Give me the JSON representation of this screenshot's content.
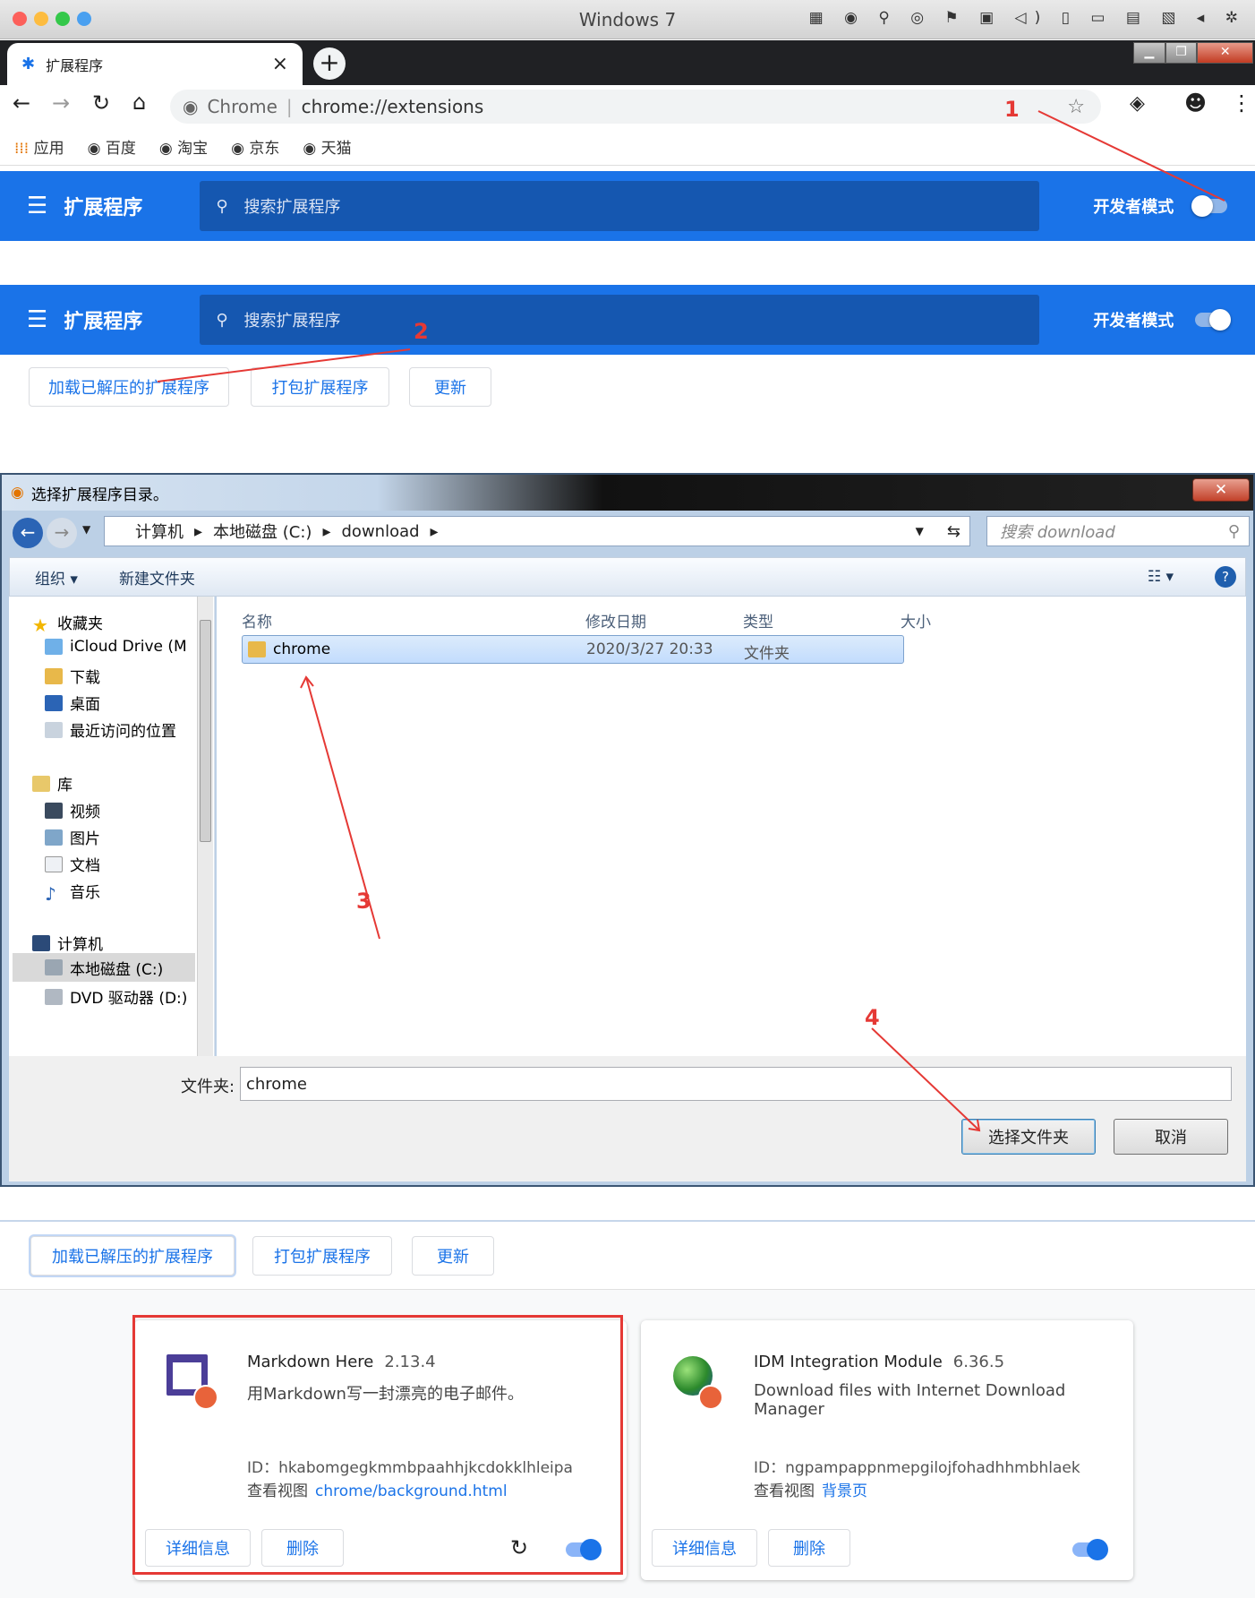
{
  "mac": {
    "title": "Windows 7",
    "icons": "▦ ◉ ⚲ ◎ ⚑ ▣ ◁) ▯ ▭ ▤ ▧ ◂ ✲"
  },
  "tab": {
    "title": "扩展程序",
    "close": "×"
  },
  "omnibox": {
    "site": "Chrome",
    "sep": "|",
    "url": "chrome://extensions"
  },
  "bookmarks": [
    {
      "label": "应用"
    },
    {
      "label": "百度"
    },
    {
      "label": "淘宝"
    },
    {
      "label": "京东"
    },
    {
      "label": "天猫"
    }
  ],
  "ext_header": {
    "title": "扩展程序",
    "search_placeholder": "搜索扩展程序",
    "dev_mode": "开发者模式"
  },
  "dev_buttons": {
    "load": "加载已解压的扩展程序",
    "pack": "打包扩展程序",
    "update": "更新"
  },
  "dialog": {
    "title": "选择扩展程序目录。",
    "breadcrumb": [
      "计算机",
      "本地磁盘 (C:)",
      "download"
    ],
    "search_placeholder": "搜索 download",
    "organize": "组织 ▾",
    "new_folder": "新建文件夹",
    "nav": {
      "favorites": "收藏夹",
      "icloud": "iCloud Drive (M",
      "downloads": "下载",
      "desktop": "桌面",
      "recent": "最近访问的位置",
      "library": "库",
      "videos": "视频",
      "pictures": "图片",
      "documents": "文档",
      "music": "音乐",
      "computer": "计算机",
      "local_disk": "本地磁盘 (C:)",
      "dvd": "DVD 驱动器 (D:)"
    },
    "columns": {
      "name": "名称",
      "modified": "修改日期",
      "type": "类型",
      "size": "大小"
    },
    "file": {
      "name": "chrome",
      "modified": "2020/3/27 20:33",
      "type": "文件夹"
    },
    "folder_label": "文件夹:",
    "folder_value": "chrome",
    "select_button": "选择文件夹",
    "cancel_button": "取消"
  },
  "extensions": [
    {
      "name": "Markdown Here",
      "version": "2.13.4",
      "desc": "用Markdown写一封漂亮的电子邮件。",
      "id": "ID：hkabomgegkmmbpaahhjkcdokklhleipa",
      "views_label": "查看视图",
      "views_link": "chrome/background.html",
      "details": "详细信息",
      "remove": "删除"
    },
    {
      "name": "IDM Integration Module",
      "version": "6.36.5",
      "desc": "Download files with Internet Download Manager",
      "id": "ID：ngpampappnmepgilojfohadhhmbhlaek",
      "views_label": "查看视图",
      "views_link": "背景页",
      "details": "详细信息",
      "remove": "删除"
    }
  ],
  "annotations": {
    "one": "1",
    "two": "2",
    "three": "3",
    "four": "4",
    "color": "#e53935"
  },
  "colors": {
    "accent": "#1a73e8",
    "header_dark": "#1557b0"
  }
}
